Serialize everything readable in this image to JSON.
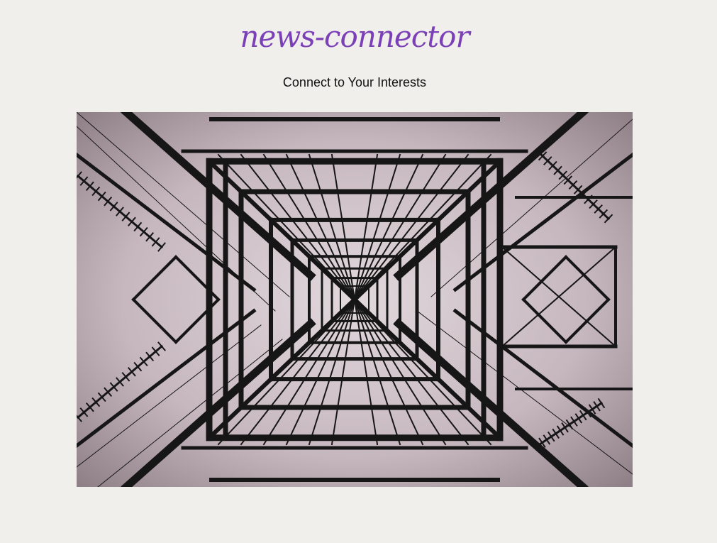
{
  "brand": {
    "logo_text": "news-connector",
    "logo_color": "#7b3fb8"
  },
  "tagline": "Connect to Your Interests",
  "hero_image": {
    "alt": "Looking up through the lattice of an electricity pylon against a pale sky"
  },
  "colors": {
    "background": "#f0efeb",
    "sky": "#cdbfc6",
    "steel": "#161616"
  }
}
